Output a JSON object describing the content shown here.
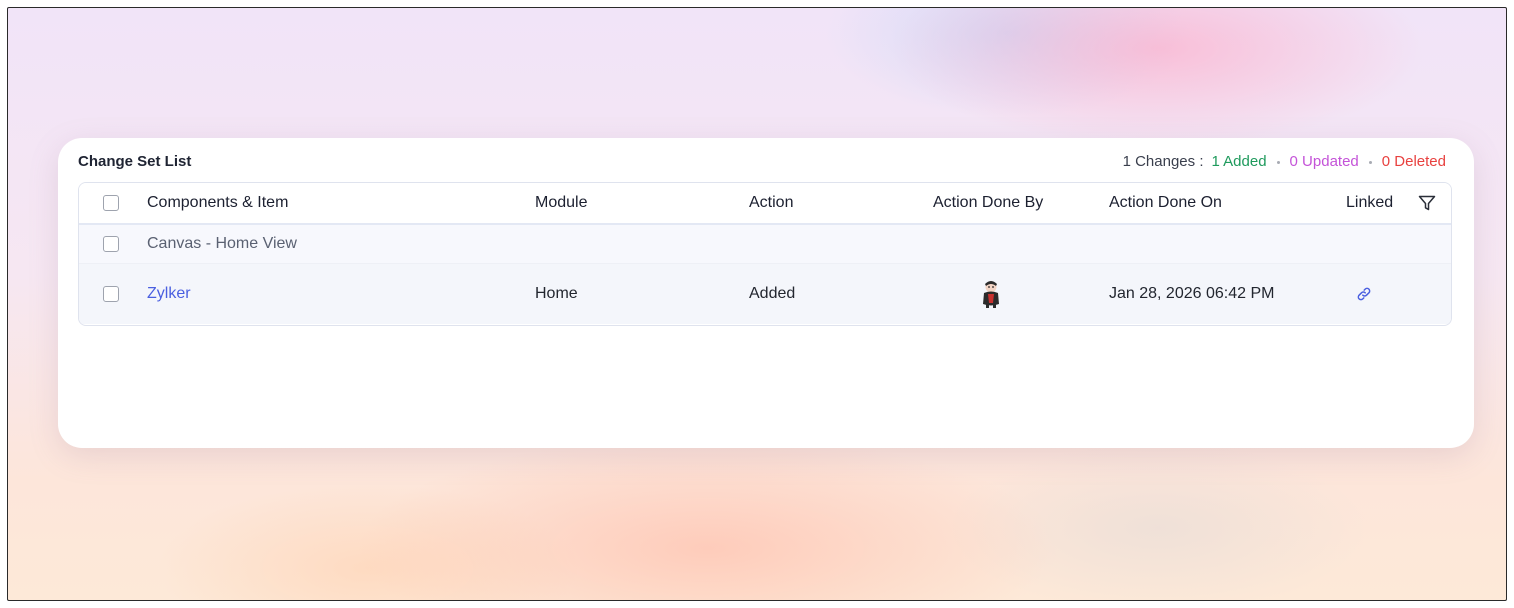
{
  "card": {
    "title": "Change Set List",
    "summary": {
      "changes": "1 Changes :",
      "added": "1 Added",
      "updated": "0 Updated",
      "deleted": "0 Deleted"
    }
  },
  "table": {
    "columns": {
      "components": "Components & Item",
      "module": "Module",
      "action": "Action",
      "action_done_by": "Action Done By",
      "action_done_on": "Action Done On",
      "linked": "Linked"
    },
    "group": {
      "name": "Canvas - Home View"
    },
    "rows": [
      {
        "item": "Zylker",
        "module": "Home",
        "action": "Added",
        "done_on": "Jan 28, 2026 06:42 PM"
      }
    ]
  },
  "icons": {
    "filter": "filter-icon",
    "linked": "link-icon",
    "avatar": "user-avatar"
  },
  "colors": {
    "added": "#1e9a5c",
    "updated": "#c453d8",
    "deleted": "#e8413f",
    "link": "#4a5fe0"
  }
}
